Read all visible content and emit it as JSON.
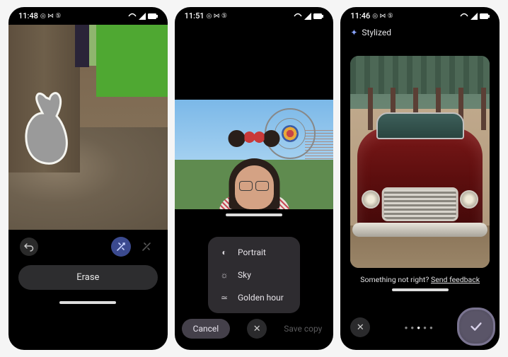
{
  "phone1": {
    "status": {
      "time": "11:48",
      "icons": "◎ ⋈ ⑤"
    },
    "erase_label": "Erase"
  },
  "phone2": {
    "status": {
      "time": "11:51",
      "icons": "◎ ⋈ ⑤"
    },
    "options": {
      "portrait": "Portrait",
      "sky": "Sky",
      "golden": "Golden hour"
    },
    "cancel": "Cancel",
    "save_copy": "Save copy"
  },
  "phone3": {
    "status": {
      "time": "11:46",
      "icons": "◎ ⋈ ⑤"
    },
    "stylized": "Stylized",
    "feedback_prefix": "Something not right? ",
    "feedback_link": "Send feedback"
  }
}
